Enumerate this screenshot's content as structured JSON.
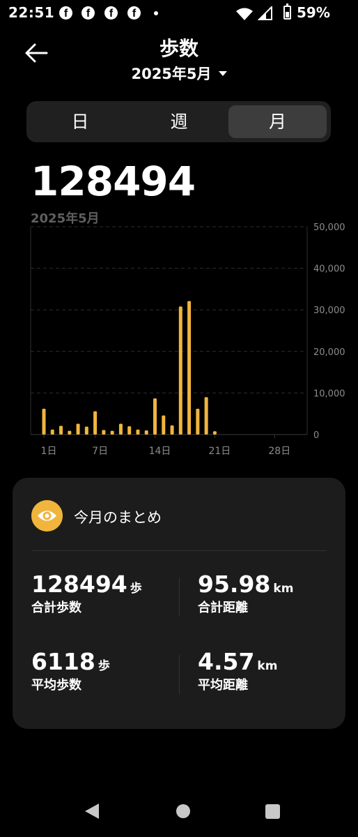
{
  "status_bar": {
    "time": "22:51",
    "notification_icons": [
      "facebook-icon",
      "facebook-icon",
      "facebook-icon",
      "facebook-icon"
    ],
    "battery_percent": "59%",
    "battery_level": 0.59
  },
  "header": {
    "title": "歩数",
    "month": "2025年5月"
  },
  "tabs": [
    {
      "label": "日",
      "selected": false
    },
    {
      "label": "週",
      "selected": false
    },
    {
      "label": "月",
      "selected": true
    }
  ],
  "summary_total": "128494",
  "summary_period": "2025年5月",
  "chart_data": {
    "type": "bar",
    "x_unit": "day of month",
    "x": [
      1,
      2,
      3,
      4,
      5,
      6,
      7,
      8,
      9,
      10,
      11,
      12,
      13,
      14,
      15,
      16,
      17,
      18,
      19,
      20,
      21,
      22,
      23,
      24,
      25,
      26,
      27,
      28,
      29,
      30,
      31
    ],
    "values": [
      6200,
      1200,
      2100,
      900,
      2600,
      1900,
      5600,
      1100,
      900,
      2600,
      2000,
      1200,
      1000,
      8700,
      4600,
      2200,
      30800,
      32100,
      6200,
      9000,
      800,
      0,
      0,
      0,
      0,
      0,
      0,
      0,
      0,
      0,
      0
    ],
    "x_tick_labels": [
      "1日",
      "7日",
      "14日",
      "21日",
      "28日"
    ],
    "x_tick_days": [
      1,
      7,
      14,
      21,
      28
    ],
    "y_ticks": [
      0,
      10000,
      20000,
      30000,
      40000,
      50000
    ],
    "y_tick_labels": [
      "0",
      "10,000",
      "20,000",
      "30,000",
      "40,000",
      "50,000"
    ],
    "ylim": [
      0,
      50000
    ],
    "y_axis_side": "right",
    "grid": "dashed horizontal",
    "bar_color": "#f1b53d"
  },
  "card": {
    "title": "今月のまとめ",
    "icon": "eye-icon",
    "accent_color": "#f1b53d",
    "stats": [
      {
        "value": "128494",
        "unit": "歩",
        "label": "合計歩数"
      },
      {
        "value": "95.98",
        "unit": "km",
        "label": "合計距離"
      },
      {
        "value": "6118",
        "unit": "歩",
        "label": "平均歩数"
      },
      {
        "value": "4.57",
        "unit": "km",
        "label": "平均距離"
      }
    ]
  },
  "nav_bar": {
    "buttons": [
      "back-triangle-icon",
      "home-circle-icon",
      "recents-square-icon"
    ]
  }
}
